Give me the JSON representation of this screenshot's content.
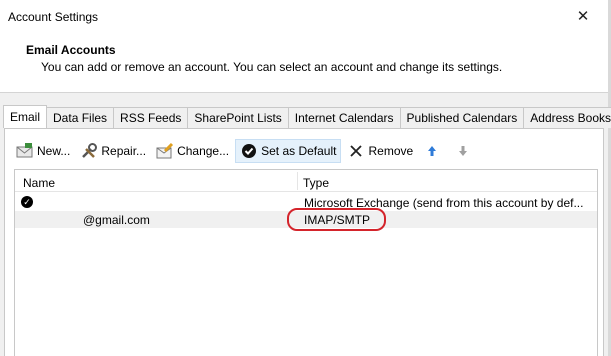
{
  "window": {
    "title": "Account Settings",
    "close_glyph": "✕"
  },
  "header": {
    "title": "Email Accounts",
    "description": "You can add or remove an account. You can select an account and change its settings."
  },
  "tabs": [
    {
      "label": "Email",
      "active": true
    },
    {
      "label": "Data Files"
    },
    {
      "label": "RSS Feeds"
    },
    {
      "label": "SharePoint Lists"
    },
    {
      "label": "Internet Calendars"
    },
    {
      "label": "Published Calendars"
    },
    {
      "label": "Address Books"
    }
  ],
  "toolbar": {
    "new_label": "New...",
    "repair_label": "Repair...",
    "change_label": "Change...",
    "set_default_label": "Set as Default",
    "remove_label": "Remove"
  },
  "grid": {
    "columns": {
      "name": "Name",
      "type": "Type"
    },
    "rows": [
      {
        "name": "",
        "type": "Microsoft Exchange (send from this account by def...",
        "is_default": true
      },
      {
        "name": "@gmail.com",
        "type": "IMAP/SMTP",
        "selected": true
      }
    ]
  },
  "colors": {
    "annotation": "#d4242b",
    "arrow_up": "#2f7bd8",
    "arrow_down": "#a0a0a0"
  }
}
